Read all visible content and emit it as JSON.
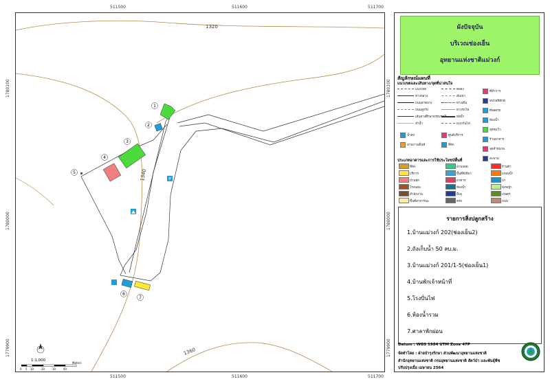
{
  "map": {
    "x_ticks": [
      "511500",
      "511600",
      "511700"
    ],
    "y_ticks": [
      "1780100",
      "1780000",
      "1779900"
    ],
    "contours": [
      "1320",
      "1340",
      "1360"
    ],
    "markers": [
      "1",
      "2",
      "3",
      "4",
      "5",
      "6",
      "7"
    ],
    "scale_text": "1:1,000",
    "scale_ticks": [
      "0",
      "5",
      "10",
      "20",
      "30",
      "40"
    ],
    "scale_unit": "Meters"
  },
  "title": {
    "line1": "ผังปัจจุบัน",
    "line2": "บริเวณช่องเย็น",
    "line3": "อุทยานแห่งชาติแม่วงก์"
  },
  "legend": {
    "heading": "สัญลักษณ์แผนที่",
    "subheading": "แนวเขตและเส้นทาง/จุดที่น่าสนใจ",
    "lines": [
      "แนวเขต",
      "ทางหลวง",
      "ถนนลาดยาง",
      "ถนนลูกรัง",
      "เส้นทางศึกษาธรรมชาติ",
      "ลำน้ำ",
      "คลอง",
      "สันเขา",
      "ทางเดิน",
      "ทางรถไฟ",
      "ท่อน้ำ",
      "แนวกันไฟ"
    ],
    "icons": [
      "ที่ทำการ",
      "หน่วยพิทักษ์",
      "ที่จอดรถ",
      "ห้องน้ำ",
      "จุดชมวิว",
      "น้ำตก",
      "ศูนย์บริการ",
      "ลานกางเต็นท์",
      "ที่พัก",
      "ร้านอาหาร",
      "จุดจำหน่าย",
      "สะพาน"
    ],
    "landuse_heading": "ประเภทอาคารและการใช้ประโยชน์พื้นที่",
    "landuse": [
      {
        "label": "ที่พัก",
        "color": "#d99a2b"
      },
      {
        "label": "บริการ",
        "color": "#ffe24a"
      },
      {
        "label": "บ้านพัก",
        "color": "#f08080"
      },
      {
        "label": "โรงนอน",
        "color": "#a0522d"
      },
      {
        "label": "สำนักงาน",
        "color": "#7a4e2d"
      },
      {
        "label": "พื้นที่สาธารณะ",
        "color": "#ffe9a8"
      },
      {
        "label": "ลานจอด",
        "color": "#33cc88"
      },
      {
        "label": "พื้นที่สีเขียว",
        "color": "#35a7c9"
      },
      {
        "label": "อาคาร",
        "color": "#e83a6a"
      },
      {
        "label": "ห้องน้ำ",
        "color": "#1f6f8b"
      },
      {
        "label": "อื่นๆ",
        "color": "#2a3b8f"
      },
      {
        "label": "คลัง",
        "color": "#666666"
      },
      {
        "label": "ร้านค้า",
        "color": "#ff2a2a"
      },
      {
        "label": "แหล่งน้ำ",
        "color": "#ff7a00"
      },
      {
        "label": "ป่า",
        "color": "#1e90d6"
      },
      {
        "label": "ทุ่งหญ้า",
        "color": "#b8f08c"
      },
      {
        "label": "เกษตร",
        "color": "#5f8a2a"
      },
      {
        "label": "ถนน",
        "color": "#c08a74"
      }
    ]
  },
  "buildings": {
    "heading": "รายการสิ่งปลูกสร้าง",
    "items": [
      "1.บ้านแม่วงก์ 202(ช่องเย็น2)",
      "2.ถังเก็บน้ำ 50 ลบ.ม.",
      "3.บ้านแม่วงก์ 201/1-5(ช่องเย็น1)",
      "4.บ้านพักเจ้าหน้าที่",
      "5.โรงปั่นไฟ",
      "6.ห้องน้ำรวม",
      "7.ศาลาพักผ่อน"
    ]
  },
  "footer": {
    "datum": "Datum  : WGS 1984 UTM Zone 47P",
    "made_by": "จัดทำโดย : ฝ่ายบำรุงรักษา ส่วนพัฒนาอุทยานแห่งชาติ",
    "office": "สำนักอุทยานแห่งชาติ กรมอุทยานแห่งชาติ สัตว์ป่า และพันธุ์พืช",
    "updated": "ปรับปรุงเมื่อ เมษายน 2564"
  },
  "colors": {
    "contour": "#b88a4a",
    "building_green": "#4cd93c",
    "building_pink": "#f08080",
    "building_yellow": "#ffe92e",
    "building_cyan": "#1e9fd8",
    "title_bg": "#9ff56a"
  }
}
